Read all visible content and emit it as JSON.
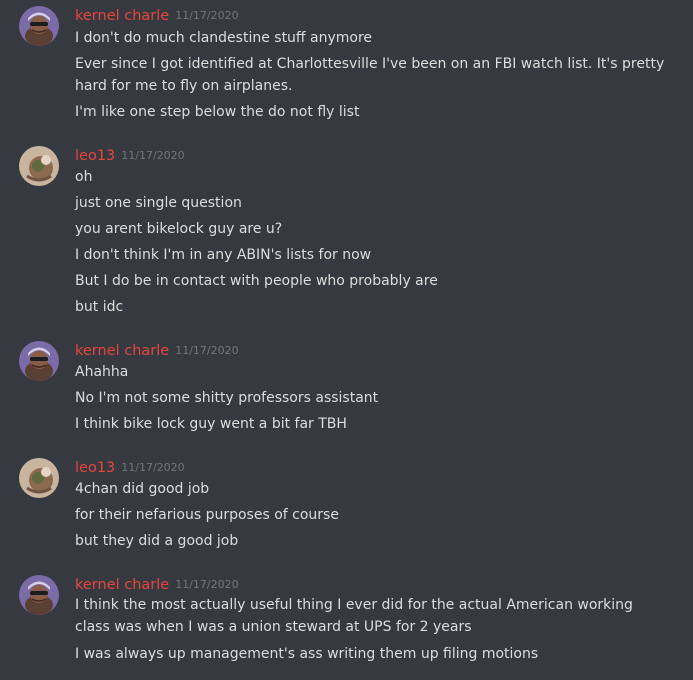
{
  "colors": {
    "background": "#36393f",
    "username_red": "#e8453c",
    "timestamp": "#72767d",
    "message_text": "#dcddde"
  },
  "groups": [
    {
      "username": "kernel charle",
      "timestamp": "11/17/2020",
      "avatar": "kernel-charle-avatar",
      "messages": [
        "I don't do much clandestine stuff anymore",
        "Ever since I got identified at Charlottesville I've been on an FBI watch list. It's pretty hard for me to fly on airplanes.",
        "I'm like one step below the do not fly list"
      ]
    },
    {
      "username": "leo13",
      "timestamp": "11/17/2020",
      "avatar": "leo13-avatar",
      "messages": [
        "oh",
        "just one single question",
        "you arent bikelock guy are u?",
        "I don't think I'm in any ABIN's lists for now",
        "But I do be in contact with people who probably are",
        "but idc"
      ]
    },
    {
      "username": "kernel charle",
      "timestamp": "11/17/2020",
      "avatar": "kernel-charle-avatar",
      "messages": [
        "Ahahha",
        "No I'm not some shitty professors assistant",
        "I think bike lock guy went a bit far TBH"
      ]
    },
    {
      "username": "leo13",
      "timestamp": "11/17/2020",
      "avatar": "leo13-avatar",
      "messages": [
        "4chan did good job",
        "for their nefarious purposes of course",
        "but they did a good job"
      ]
    },
    {
      "username": "kernel charle",
      "timestamp": "11/17/2020",
      "avatar": "kernel-charle-avatar",
      "messages": [
        "I think the most actually useful thing I ever did for the actual American working class was when I was a union steward at UPS for 2 years",
        "I was always up management's ass writing them up filing motions"
      ]
    }
  ]
}
